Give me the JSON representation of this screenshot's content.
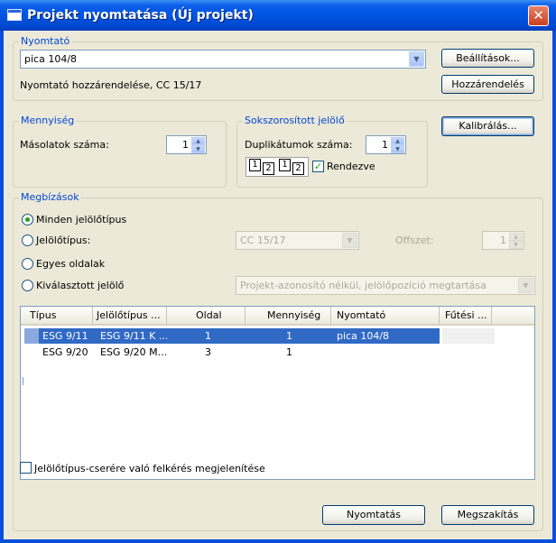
{
  "window": {
    "title": "Projekt nyomtatása (Új projekt)"
  },
  "printer": {
    "legend": "Nyomtató",
    "selected": "pica 104/8",
    "assignment": "Nyomtató hozzárendelése, CC 15/17",
    "settings_button": "Beállítások...",
    "assign_button": "Hozzárendelés"
  },
  "quantity": {
    "legend": "Mennyiség",
    "copies_label": "Másolatok száma:",
    "copies_value": "1"
  },
  "collate": {
    "legend": "Sokszorosított jelölő",
    "duplicates_label": "Duplikátumok száma:",
    "duplicates_value": "1",
    "collate_label": "Rendezve",
    "collate_checked": true,
    "icon_pages": [
      "1",
      "2",
      "1",
      "2"
    ]
  },
  "calibrate_button": "Kalibrálás...",
  "orders": {
    "legend": "Megbízások",
    "options": [
      {
        "label": "Minden jelölőtípus",
        "selected": true
      },
      {
        "label": "Jelölőtípus:",
        "selected": false
      },
      {
        "label": "Egyes oldalak",
        "selected": false
      },
      {
        "label": "Kiválasztott jelölő",
        "selected": false
      }
    ],
    "marker_type_value": "CC 15/17",
    "offset_label": "Offszet:",
    "offset_value": "1",
    "selected_marker_value": "Projekt-azonosító nélkül, jelölőpozíció megtartása"
  },
  "table": {
    "columns": [
      "Típus",
      "Jelölőtípus ...",
      "Oldal",
      "Mennyiség",
      "Nyomtató",
      "Fűtési ..."
    ],
    "rows": [
      {
        "type": "ESG 9/11",
        "marker": "ESG 9/11 K ...",
        "page": "1",
        "qty": "1",
        "printer": "pica 104/8",
        "heat": "",
        "selected": true
      },
      {
        "type": "ESG 9/20",
        "marker": "ESG 9/20 M...",
        "page": "3",
        "qty": "1",
        "printer": "",
        "heat": "",
        "selected": false
      }
    ]
  },
  "prompt_checkbox": {
    "label": "Jelölőtípus-cserére való felkérés megjelenítése",
    "checked": false
  },
  "buttons": {
    "print": "Nyomtatás",
    "cancel": "Megszakítás"
  }
}
